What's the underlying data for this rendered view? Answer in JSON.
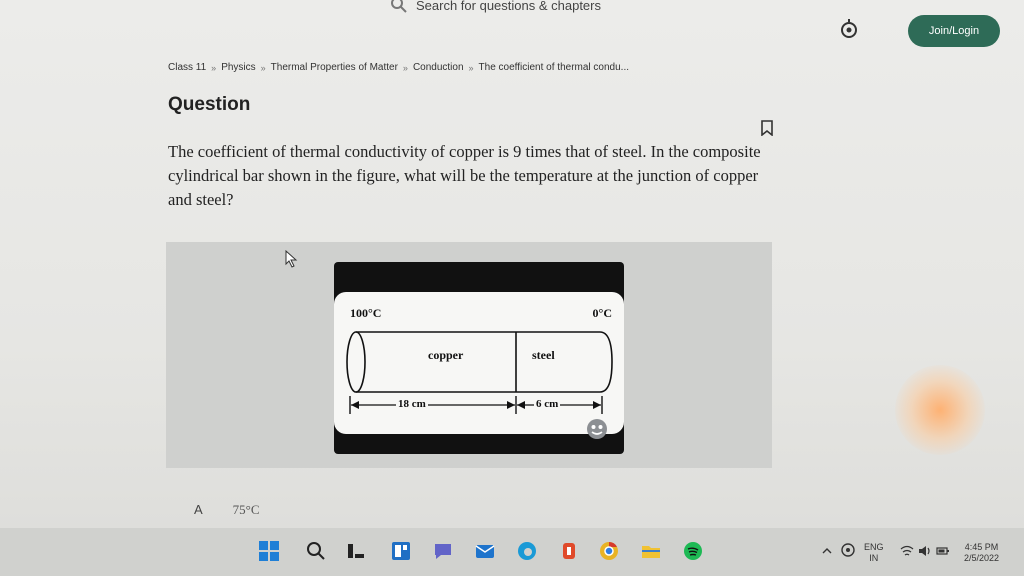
{
  "header": {
    "search_placeholder": "Search for questions & chapters",
    "join_label": "Join/Login"
  },
  "breadcrumb": {
    "items": [
      "Class 11",
      "Physics",
      "Thermal Properties of Matter",
      "Conduction",
      "The coefficient of thermal condu..."
    ],
    "separator": "»"
  },
  "question": {
    "heading": "Question",
    "text": "The coefficient of thermal conductivity of copper is 9 times that of steel. In the composite cylindrical bar shown in the figure, what will be the temperature at the junction of copper and steel?"
  },
  "figure": {
    "left_temp": "100°C",
    "right_temp": "0°C",
    "left_segment": "copper",
    "right_segment": "steel",
    "left_length": "18 cm",
    "right_length": "6 cm"
  },
  "options": [
    {
      "letter": "A",
      "value": "75°C"
    }
  ],
  "taskbar": {
    "lang_top": "ENG",
    "lang_bottom": "IN",
    "time": "4:45 PM",
    "date": "2/5/2022"
  },
  "colors": {
    "accent": "#2e6b57",
    "background": "#e8e8e6"
  },
  "icons": [
    "search-icon",
    "alert-icon",
    "bookmark-icon",
    "cursor-icon",
    "windows-start-icon"
  ]
}
